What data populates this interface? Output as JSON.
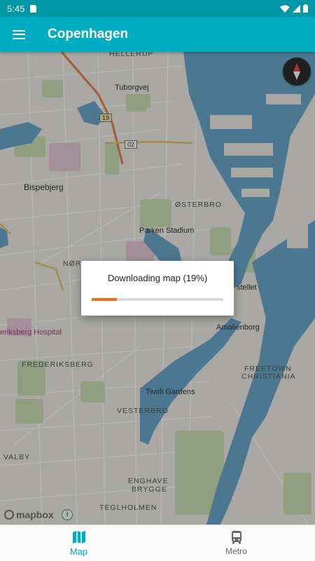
{
  "status_bar": {
    "time": "5:45"
  },
  "app_bar": {
    "title": "Copenhagen"
  },
  "map": {
    "labels": {
      "hellerup": "HELLERUP",
      "tuborgvej": "Tuborgvej",
      "road_19": "19",
      "road_02": "02",
      "bispebjerg": "Bispebjerg",
      "osterbro": "ØSTERBRO",
      "parken": "Parken Stadium",
      "nor": "NØR",
      "kastellet": "stellet",
      "amalienborg": "Amalienborg",
      "frederiksberg_hospital": "eriksberg Hospital",
      "frederiksberg": "FREDERIKSBERG",
      "freetown": "FREETOWN",
      "christiania": "CHRISTIANIA",
      "tivoli": "Tivoli Gardens",
      "vesterbro": "VESTERBRO",
      "valby": "VALBY",
      "enghave": "ENGHAVE",
      "brygge": "BRYGGE",
      "teglholmen": "TEGLHOLMEN"
    },
    "attribution": "mapbox",
    "info": "i"
  },
  "dialog": {
    "message": "Downloading map (19%)",
    "progress": 0.19
  },
  "bottom_nav": {
    "items": [
      {
        "label": "Map",
        "icon": "map-icon",
        "active": true
      },
      {
        "label": "Metro",
        "icon": "bus-icon",
        "active": false
      }
    ]
  },
  "colors": {
    "app_bar": "#00acc1",
    "status_bar": "#0097a7",
    "progress": "#f26b21",
    "water": "#6aa6c9",
    "park": "#c8ddb0"
  }
}
